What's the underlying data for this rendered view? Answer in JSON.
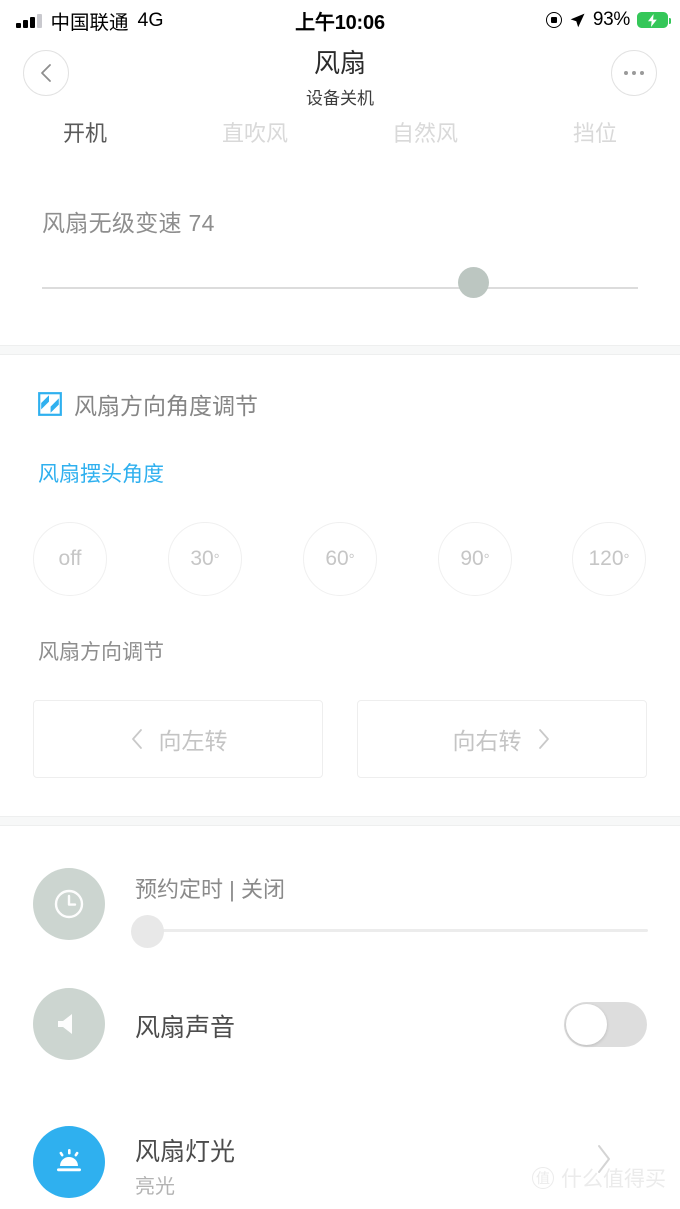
{
  "status_bar": {
    "carrier": "中国联通",
    "network": "4G",
    "time": "上午10:06",
    "battery_percent": "93%",
    "signal_icon": "signal-bars-icon",
    "rotation_lock_icon": "rotation-lock-icon",
    "location_icon": "location-arrow-icon",
    "battery_icon": "battery-charging-icon"
  },
  "header": {
    "back_icon": "chevron-left-icon",
    "more_icon": "more-dots-icon",
    "title": "风扇",
    "subtitle": "设备关机"
  },
  "mode_tabs": [
    {
      "label": "开机",
      "active": true
    },
    {
      "label": "直吹风",
      "active": false
    },
    {
      "label": "自然风",
      "active": false
    },
    {
      "label": "挡位",
      "active": false
    }
  ],
  "speed": {
    "label": "风扇无级变速 74",
    "value": 74,
    "min": 0,
    "max": 100
  },
  "direction_section": {
    "icon": "pattern-square-icon",
    "heading": "风扇方向角度调节",
    "swing_link": "风扇摆头角度",
    "angle_options": [
      {
        "label": "off",
        "degree": false
      },
      {
        "label": "30",
        "degree": true
      },
      {
        "label": "60",
        "degree": true
      },
      {
        "label": "90",
        "degree": true
      },
      {
        "label": "120",
        "degree": true
      }
    ],
    "direction_label": "风扇方向调节",
    "turn_left": "向左转",
    "turn_right": "向右转",
    "left_icon": "chevron-left-icon",
    "right_icon": "chevron-right-icon"
  },
  "rows": {
    "timer": {
      "icon": "clock-icon",
      "title": "预约定时 | 关闭",
      "slider_value": 0
    },
    "sound": {
      "icon": "speaker-icon",
      "title": "风扇声音",
      "toggle_state": "off"
    },
    "light": {
      "icon": "light-sunrise-icon",
      "title": "风扇灯光",
      "subtitle": "亮光",
      "chevron_icon": "chevron-right-icon"
    }
  },
  "watermark": {
    "logo_char": "值",
    "text": "什么值得买"
  },
  "colors": {
    "accent_blue": "#2fb0ef",
    "battery_green": "#35c759",
    "icon_gray": "#ccd5d0",
    "thumb_gray": "#bcc6c1"
  }
}
